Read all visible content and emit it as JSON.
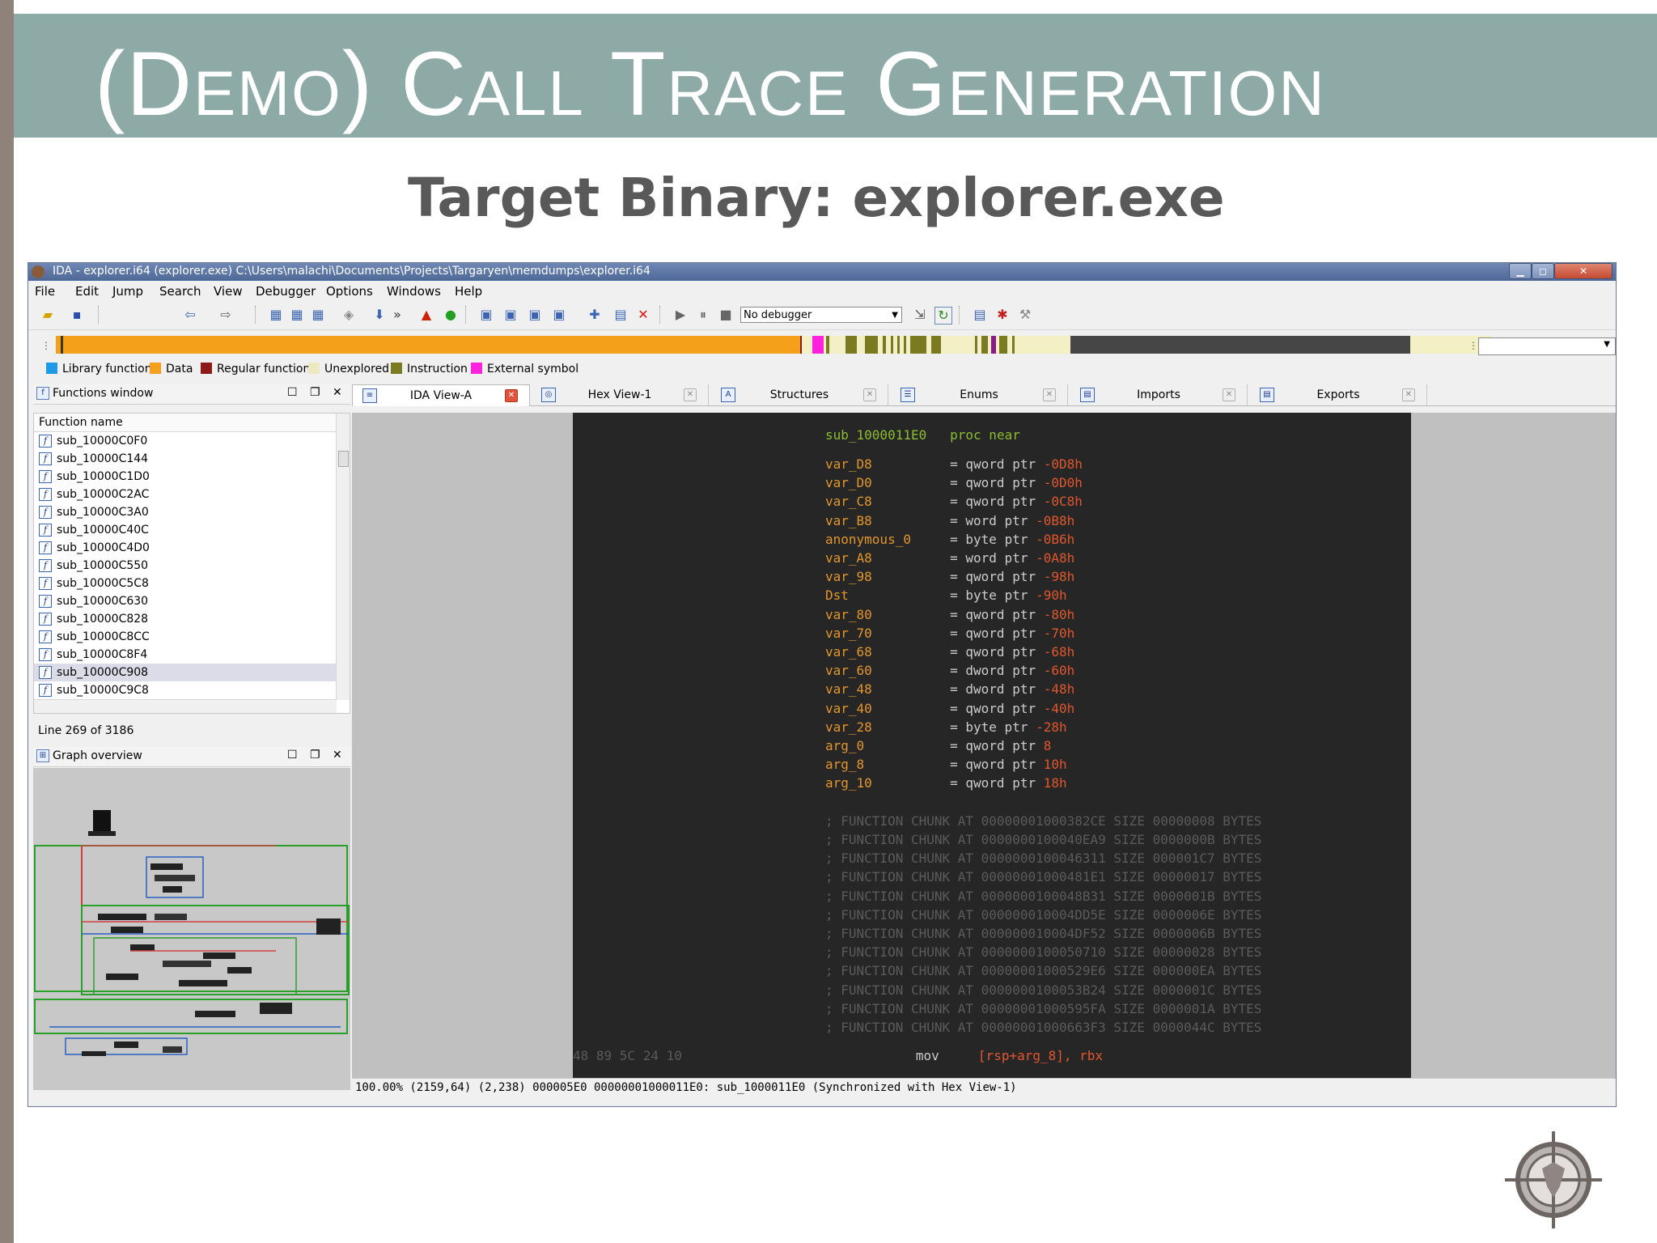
{
  "slide": {
    "title": "(Demo) Call Trace Generation",
    "subtitle": "Target Binary: explorer.exe"
  },
  "window": {
    "title": "IDA - explorer.i64 (explorer.exe) C:\\Users\\malachi\\Documents\\Projects\\Targaryen\\memdumps\\explorer.i64",
    "controls": [
      "minimize",
      "maximize",
      "close"
    ]
  },
  "menu": [
    "File",
    "Edit",
    "Jump",
    "Search",
    "View",
    "Debugger",
    "Options",
    "Windows",
    "Help"
  ],
  "toolbar": {
    "debugger_select": "No debugger",
    "icons": [
      "open-icon",
      "save-icon",
      "back-icon",
      "forward-icon",
      "search-icon",
      "run-icon",
      "pause-icon",
      "stop-icon",
      "delete-icon"
    ]
  },
  "legend": [
    {
      "label": "Library function",
      "color": "#1e9be8"
    },
    {
      "label": "Data",
      "color": "#f5a01a"
    },
    {
      "label": "Regular function",
      "color": "#8b1a1a"
    },
    {
      "label": "Unexplored",
      "color": "#ece8c0"
    },
    {
      "label": "Instruction",
      "color": "#7a7a20"
    },
    {
      "label": "External symbol",
      "color": "#ff22dd"
    }
  ],
  "functions_window": {
    "title": "Functions window",
    "column": "Function name",
    "items": [
      "sub_10000C0F0",
      "sub_10000C144",
      "sub_10000C1D0",
      "sub_10000C2AC",
      "sub_10000C3A0",
      "sub_10000C40C",
      "sub_10000C4D0",
      "sub_10000C550",
      "sub_10000C5C8",
      "sub_10000C630",
      "sub_10000C828",
      "sub_10000C8CC",
      "sub_10000C8F4",
      "sub_10000C908",
      "sub_10000C9C8"
    ],
    "selected_index": 13,
    "status": "Line 269 of 3186"
  },
  "graph_overview": {
    "title": "Graph overview"
  },
  "tabs": [
    {
      "label": "IDA View-A",
      "active": true
    },
    {
      "label": "Hex View-1",
      "active": false
    },
    {
      "label": "Structures",
      "active": false
    },
    {
      "label": "Enums",
      "active": false
    },
    {
      "label": "Imports",
      "active": false
    },
    {
      "label": "Exports",
      "active": false
    }
  ],
  "disasm": {
    "proc_name": "sub_1000011E0",
    "proc_kw": "proc near",
    "vars": [
      {
        "name": "var_D8",
        "type": "= qword ptr",
        "off": "-0D8h"
      },
      {
        "name": "var_D0",
        "type": "= qword ptr",
        "off": "-0D0h"
      },
      {
        "name": "var_C8",
        "type": "= qword ptr",
        "off": "-0C8h"
      },
      {
        "name": "var_B8",
        "type": "= word ptr",
        "off": "-0B8h"
      },
      {
        "name": "anonymous_0",
        "type": "= byte ptr",
        "off": "-0B6h"
      },
      {
        "name": "var_A8",
        "type": "= word ptr",
        "off": "-0A8h"
      },
      {
        "name": "var_98",
        "type": "= qword ptr",
        "off": "-98h"
      },
      {
        "name": "Dst",
        "type": "= byte ptr",
        "off": "-90h"
      },
      {
        "name": "var_80",
        "type": "= qword ptr",
        "off": "-80h"
      },
      {
        "name": "var_70",
        "type": "= qword ptr",
        "off": "-70h"
      },
      {
        "name": "var_68",
        "type": "= qword ptr",
        "off": "-68h"
      },
      {
        "name": "var_60",
        "type": "= dword ptr",
        "off": "-60h"
      },
      {
        "name": "var_48",
        "type": "= dword ptr",
        "off": "-48h"
      },
      {
        "name": "var_40",
        "type": "= qword ptr",
        "off": "-40h"
      },
      {
        "name": "var_28",
        "type": "= byte ptr",
        "off": "-28h"
      },
      {
        "name": "arg_0",
        "type": "= qword ptr",
        "off": "8"
      },
      {
        "name": "arg_8",
        "type": "= qword ptr",
        "off": "10h"
      },
      {
        "name": "arg_10",
        "type": "= qword ptr",
        "off": "18h"
      }
    ],
    "chunks": [
      "; FUNCTION CHUNK AT 00000001000382CE SIZE 00000008 BYTES",
      "; FUNCTION CHUNK AT 0000000100040EA9 SIZE 0000000B BYTES",
      "; FUNCTION CHUNK AT 0000000100046311 SIZE 000001C7 BYTES",
      "; FUNCTION CHUNK AT 00000001000481E1 SIZE 00000017 BYTES",
      "; FUNCTION CHUNK AT 0000000100048B31 SIZE 0000001B BYTES",
      "; FUNCTION CHUNK AT 000000010004DD5E SIZE 0000006E BYTES",
      "; FUNCTION CHUNK AT 000000010004DF52 SIZE 0000006B BYTES",
      "; FUNCTION CHUNK AT 0000000100050710 SIZE 00000028 BYTES",
      "; FUNCTION CHUNK AT 00000001000529E6 SIZE 000000EA BYTES",
      "; FUNCTION CHUNK AT 0000000100053B24 SIZE 0000001C BYTES",
      "; FUNCTION CHUNK AT 00000001000595FA SIZE 0000001A BYTES",
      "; FUNCTION CHUNK AT 00000001000663F3 SIZE 0000044C BYTES"
    ],
    "last_line": {
      "bytes": "48 89 5C 24 10",
      "mnemonic": "mov",
      "operand": "[rsp+arg_8], rbx"
    }
  },
  "statusbar": "100.00% (2159,64) (2,238) 000005E0 00000001000011E0: sub_1000011E0 (Synchronized with Hex View-1)"
}
